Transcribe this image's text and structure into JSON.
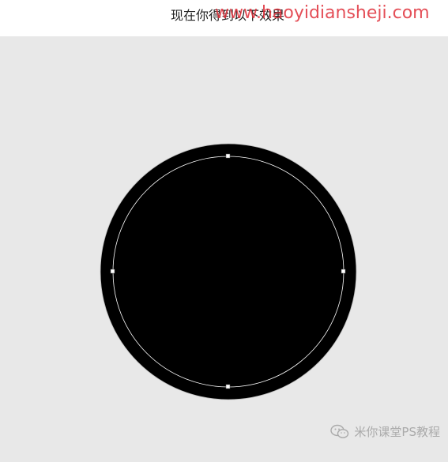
{
  "caption": {
    "text": "现在你得到以下效果"
  },
  "watermarks": {
    "url": "www.haoyidiansheji.com",
    "brand": "米你课堂PS教程"
  },
  "icons": {
    "brand_icon": "wechat-icon"
  },
  "colors": {
    "canvas_background": "#e8e8e8",
    "shape_fill": "#000000",
    "path_stroke": "#ffffff",
    "url_watermark": "#e0303a"
  }
}
